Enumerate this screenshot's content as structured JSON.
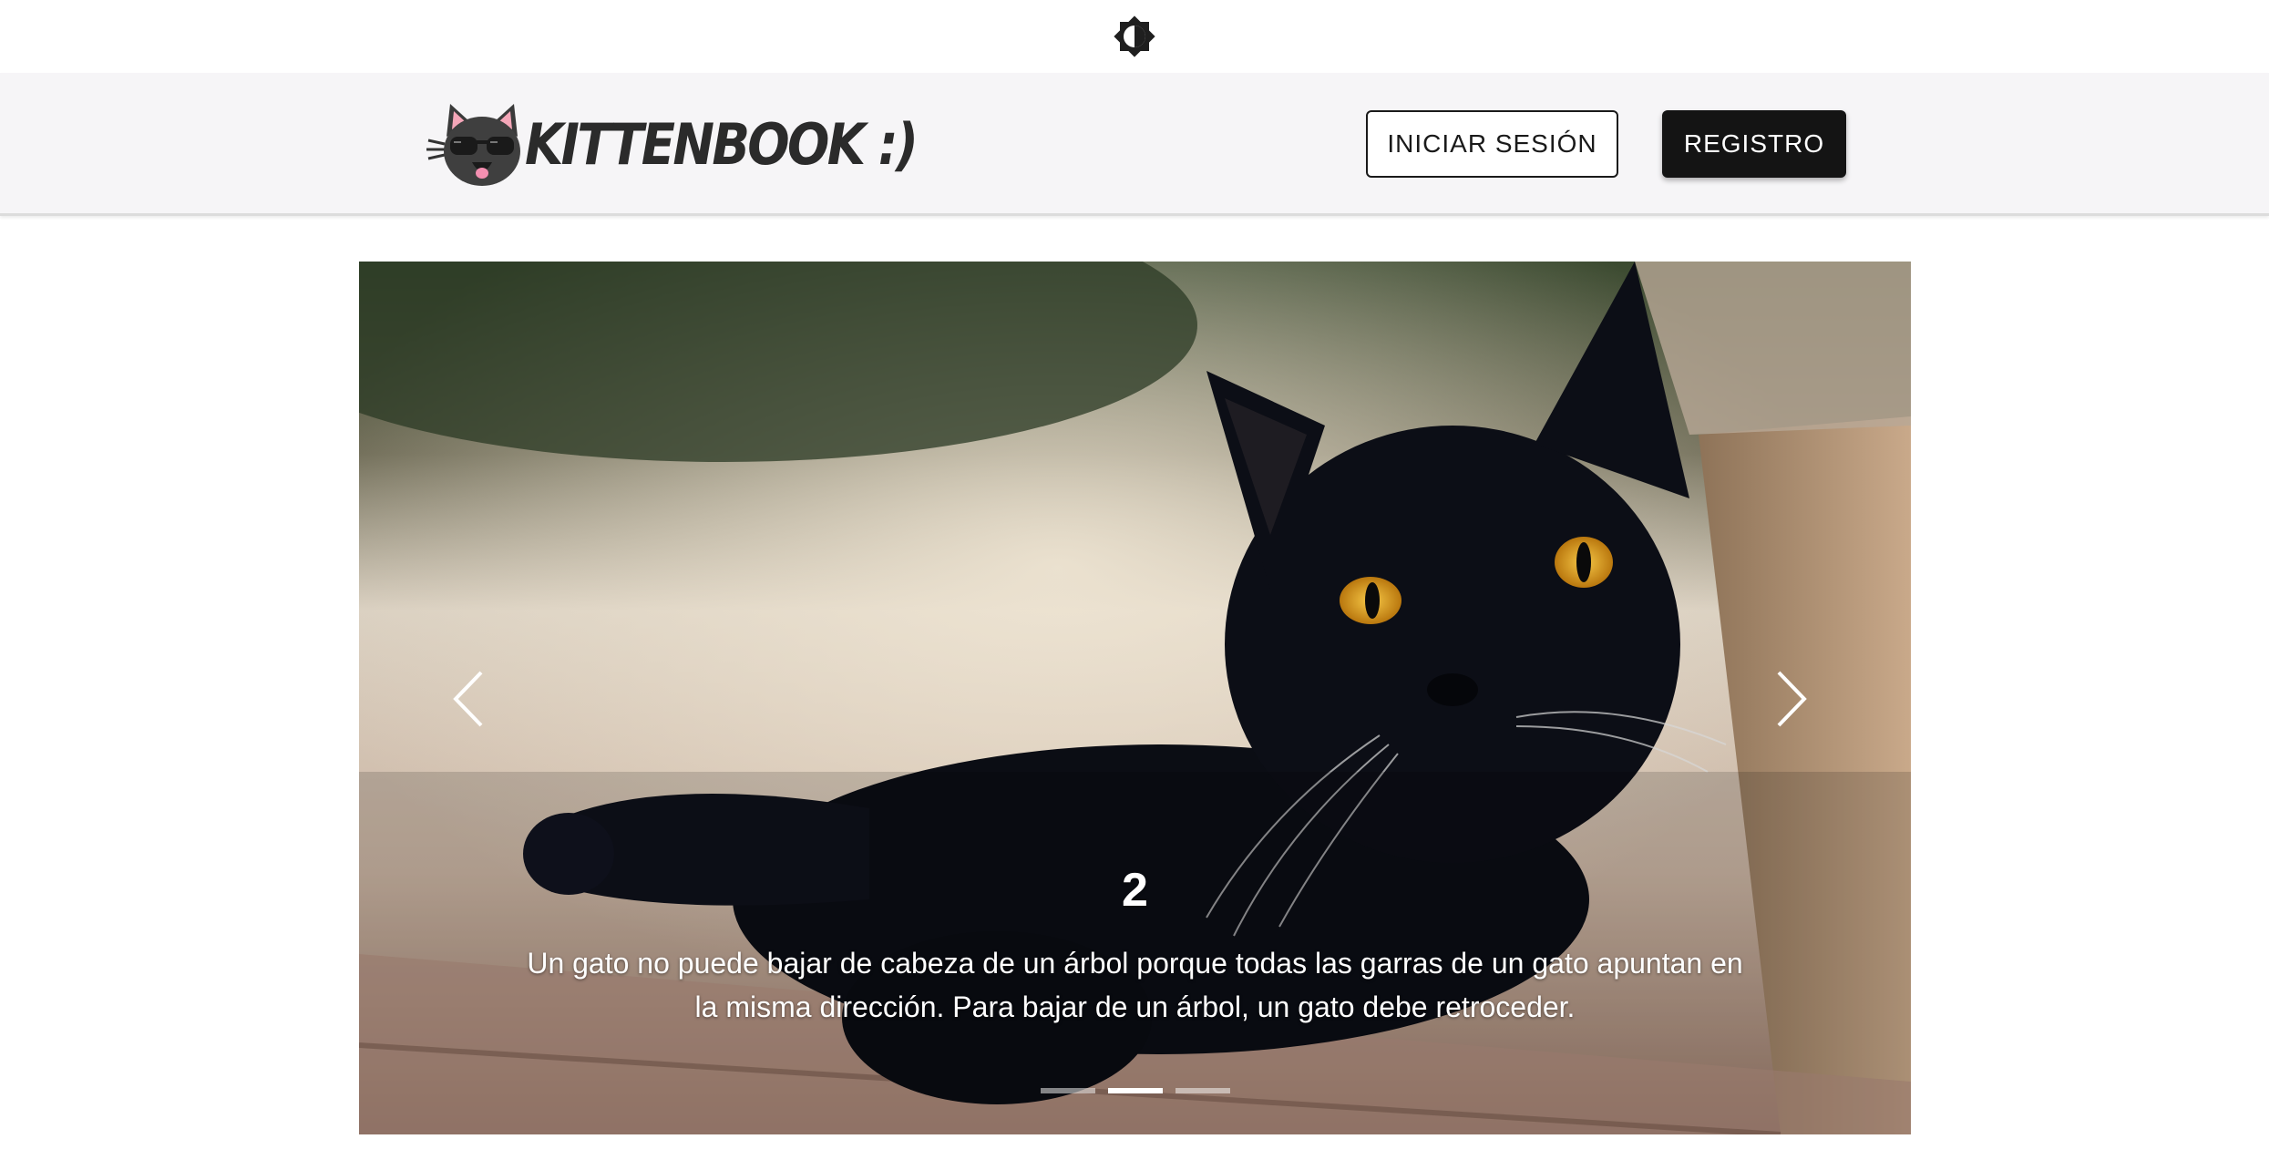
{
  "theme_toggle": {
    "icon": "brightness-icon"
  },
  "header": {
    "brand": {
      "name": "KITTENBOOK :)",
      "logo": "cat-sunglasses-logo"
    },
    "login_label": "INICIAR SESIÓN",
    "register_label": "REGISTRO"
  },
  "carousel": {
    "slide_count": 3,
    "active_index": 1,
    "image": "black-cat-photo",
    "caption": {
      "title": "2",
      "text": "Un gato no puede bajar de cabeza de un árbol porque todas las garras de un gato apuntan en la misma dirección. Para bajar de un árbol, un gato debe retroceder."
    },
    "prev_icon": "chevron-left-icon",
    "next_icon": "chevron-right-icon"
  },
  "colors": {
    "header_bg": "#f6f5f7",
    "primary_button": "#141414",
    "outline_button_border": "#1a1a1a"
  }
}
